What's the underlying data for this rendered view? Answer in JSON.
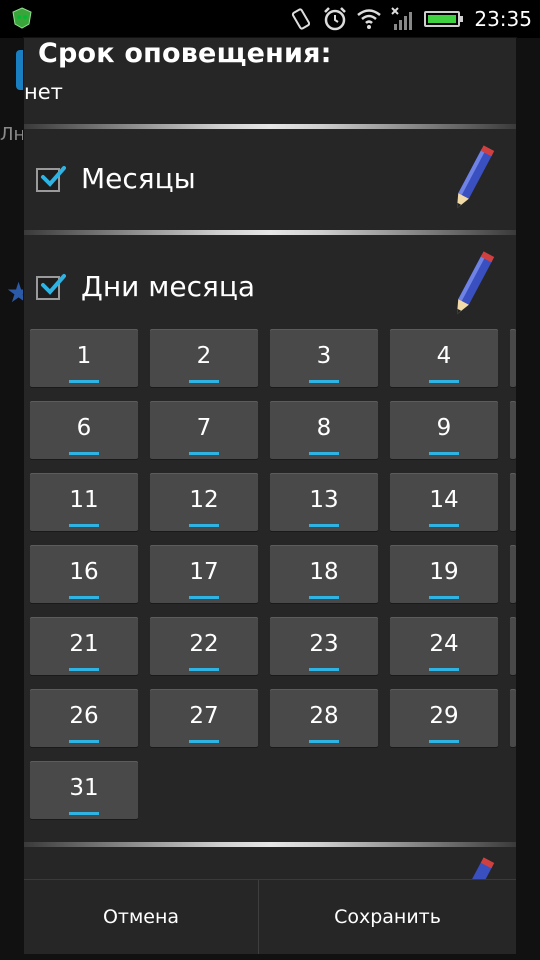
{
  "statusbar": {
    "time": "23:35",
    "icons": [
      "app-shield-icon",
      "rotate-icon",
      "alarm-icon",
      "wifi-icon",
      "signal-icon",
      "battery-icon"
    ],
    "battery_color": "#3fd13f"
  },
  "background_app": {
    "stub_text": "Лн"
  },
  "dialog": {
    "title": "Срок оповещения:",
    "subtitle": "нет",
    "sections": [
      {
        "label": "Месяцы",
        "checked": true,
        "icon": "pencil-icon"
      },
      {
        "label": "Дни месяца",
        "checked": true,
        "icon": "pencil-icon"
      }
    ],
    "days": [
      "1",
      "2",
      "3",
      "4",
      "6",
      "7",
      "8",
      "9",
      "11",
      "12",
      "13",
      "14",
      "16",
      "17",
      "18",
      "19",
      "21",
      "22",
      "23",
      "24",
      "26",
      "27",
      "28",
      "29",
      "31"
    ],
    "accent_color": "#2fb3e3",
    "buttons": {
      "cancel": "Отмена",
      "save": "Сохранить"
    }
  }
}
